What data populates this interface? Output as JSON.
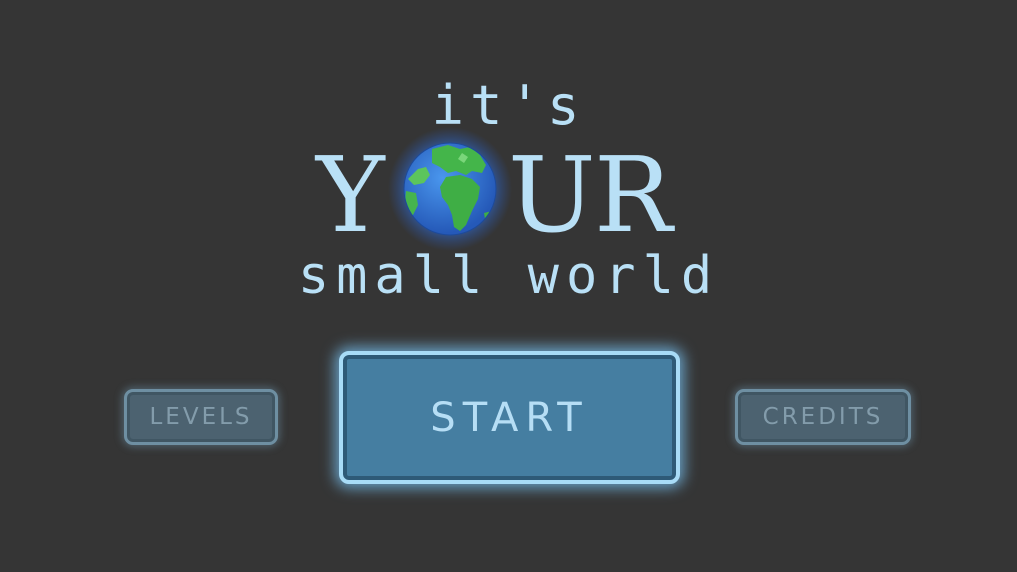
{
  "title": {
    "top": "it's",
    "middle_left": "Y",
    "middle_right_u": "U",
    "middle_right_r": "R",
    "bottom": "small world"
  },
  "buttons": {
    "levels": "LEVELS",
    "start": "START",
    "credits": "CREDITS"
  },
  "colors": {
    "background": "#353535",
    "title_text": "#b9e0f6",
    "start_button": "#457ea1",
    "start_glow": "#78c4f6",
    "side_button": "#4c6270"
  },
  "icons": {
    "globe": "earth-globe-icon"
  }
}
